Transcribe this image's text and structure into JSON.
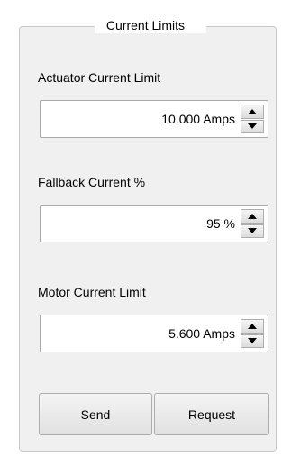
{
  "group": {
    "title": "Current Limits"
  },
  "fields": [
    {
      "label": "Actuator Current Limit",
      "value": "10.000 Amps"
    },
    {
      "label": "Fallback Current %",
      "value": "95 %"
    },
    {
      "label": "Motor Current Limit",
      "value": "5.600 Amps"
    }
  ],
  "buttons": {
    "send": "Send",
    "request": "Request"
  },
  "icons": {
    "spin_up": "triangle-up-icon",
    "spin_down": "triangle-down-icon"
  }
}
